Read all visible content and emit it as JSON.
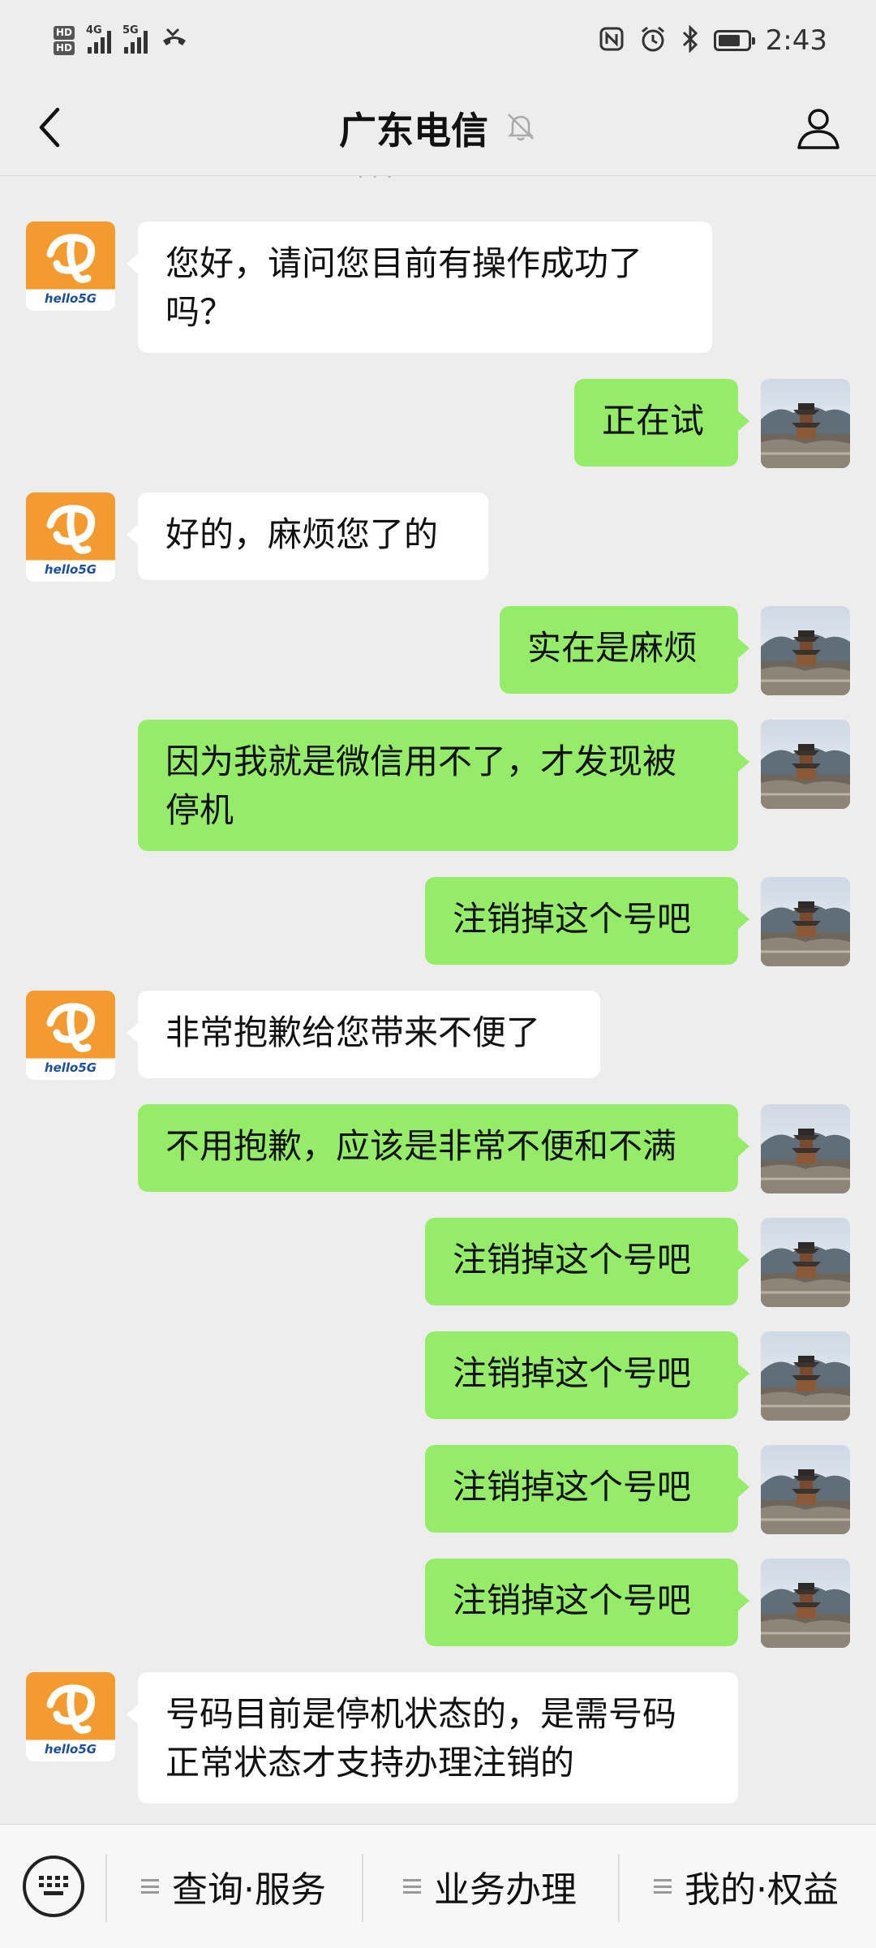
{
  "status_bar": {
    "left": {
      "hd_labels": [
        "HD",
        "HD"
      ],
      "net1": "4G",
      "net2": "5G"
    },
    "icons": [
      "nfc-icon",
      "alarm-icon",
      "bluetooth-icon"
    ],
    "battery_level": 0.75,
    "time": "2:43"
  },
  "header": {
    "back_icon": "chevron-left-icon",
    "title": "广东电信",
    "mute_icon": "bell-off-icon",
    "profile_icon": "person-icon"
  },
  "colors": {
    "background": "#ededed",
    "bubble_sent": "#95ec69",
    "bubble_received": "#ffffff",
    "telecom_orange": "#f39b2f"
  },
  "avatars": {
    "telecom_caption": "hello5G"
  },
  "messages": [
    {
      "from": "them",
      "lines": [
        "您好，请问您目前有操作成功了",
        "吗？"
      ]
    },
    {
      "from": "me",
      "lines": [
        "正在试"
      ]
    },
    {
      "from": "them",
      "lines": [
        "好的，麻烦您了的"
      ]
    },
    {
      "from": "me",
      "lines": [
        "实在是麻烦"
      ]
    },
    {
      "from": "me",
      "lines": [
        "因为我就是微信用不了，才发现被",
        "停机"
      ]
    },
    {
      "from": "me",
      "lines": [
        "注销掉这个号吧"
      ]
    },
    {
      "from": "them",
      "lines": [
        "非常抱歉给您带来不便了"
      ]
    },
    {
      "from": "me",
      "lines": [
        "不用抱歉，应该是非常不便和不满"
      ]
    },
    {
      "from": "me",
      "lines": [
        "注销掉这个号吧"
      ]
    },
    {
      "from": "me",
      "lines": [
        "注销掉这个号吧"
      ]
    },
    {
      "from": "me",
      "lines": [
        "注销掉这个号吧"
      ]
    },
    {
      "from": "me",
      "lines": [
        "注销掉这个号吧"
      ]
    },
    {
      "from": "them",
      "lines": [
        "号码目前是停机状态的，是需号码",
        "正常状态才支持办理注销的"
      ]
    }
  ],
  "bottom_menu": {
    "keyboard_icon": "keyboard-icon",
    "items": [
      {
        "label": "查询·服务"
      },
      {
        "label": "业务办理"
      },
      {
        "label": "我的·权益"
      }
    ]
  }
}
